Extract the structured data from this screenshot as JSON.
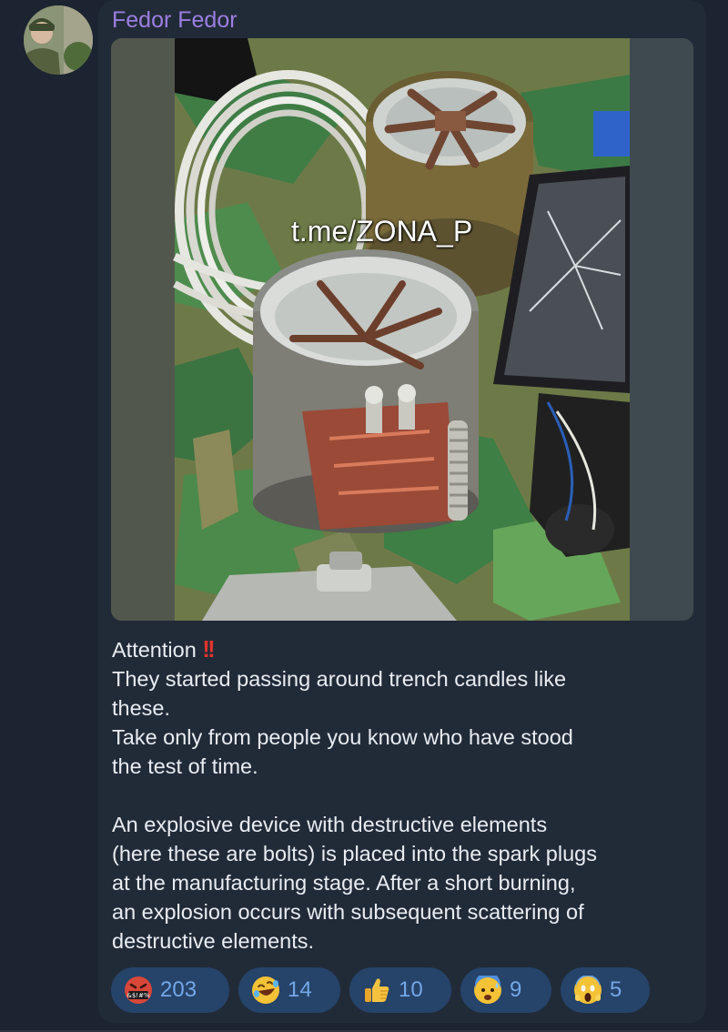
{
  "message": {
    "sender_name": "Fedor Fedor",
    "media": {
      "watermark": "t.me/ZONA_P"
    },
    "caption": {
      "line1": "Attention",
      "alert_icon": "double-exclamation-icon",
      "para1": "They started passing around trench candles like\nthese.\nTake only from people you know who have stood\nthe test of time.",
      "para2": "An explosive device with destructive elements\n(here these are bolts) is placed into the spark plugs\nat the manufacturing stage. After a short burning,\nan explosion occurs with subsequent scattering of\ndestructive elements."
    },
    "reactions": [
      {
        "icon": "angry-cursing-face-icon",
        "count": "203"
      },
      {
        "icon": "rolling-on-floor-laughing-icon",
        "count": "14"
      },
      {
        "icon": "thumbs-up-icon",
        "count": "10"
      },
      {
        "icon": "anxious-face-with-sweat-icon",
        "count": "9"
      },
      {
        "icon": "face-screaming-in-fear-icon",
        "count": "5"
      }
    ]
  },
  "colors": {
    "background": "#1b2430",
    "bubble": "#212b38",
    "sender_name": "#9b7fe0",
    "text": "#e9edf2",
    "reaction_pill": "#26436a",
    "reaction_count": "#72a8e8",
    "alert": "#e0342f"
  }
}
